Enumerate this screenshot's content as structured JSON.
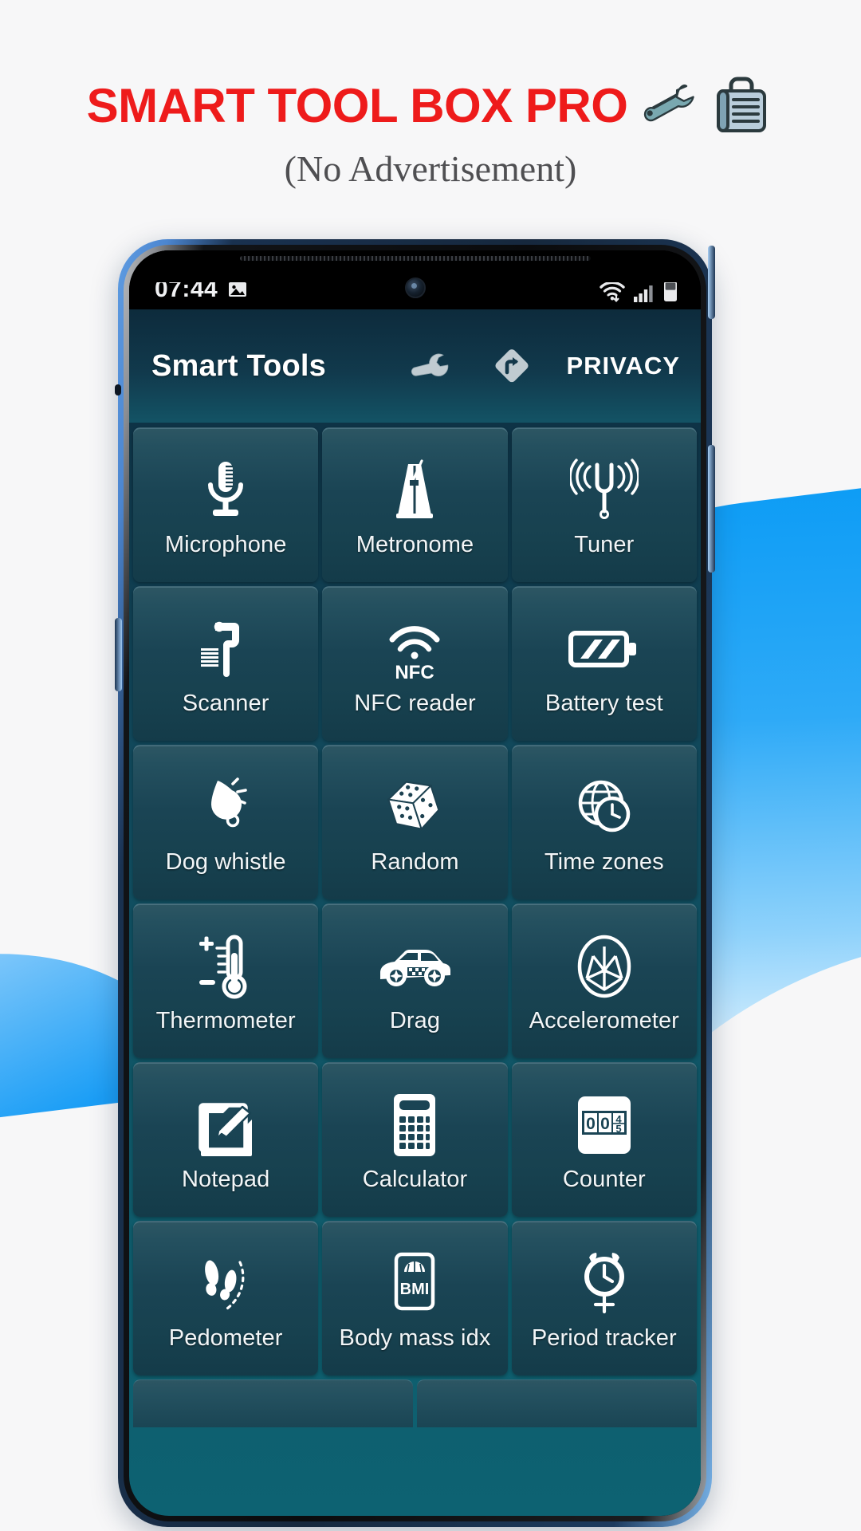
{
  "promo": {
    "title": "SMART TOOL BOX PRO",
    "subtitle": "(No Advertisement)",
    "title_color": "#ee1b1b",
    "subtitle_color": "#4f4f52",
    "icons": [
      "wrench-icon",
      "toolbox-icon"
    ]
  },
  "phone": {
    "statusbar": {
      "time": "07:44",
      "left_icons": [
        "photo-icon"
      ],
      "right_icons": [
        "wifi-icon",
        "signal-icon",
        "battery-icon"
      ]
    },
    "appbar": {
      "title": "Smart Tools",
      "wrench_icon": "wrench-icon",
      "navigation_icon": "navigation-diamond-icon",
      "privacy_label": "PRIVACY"
    },
    "grid": {
      "tiles": [
        {
          "label": "Microphone",
          "icon": "microphone-icon"
        },
        {
          "label": "Metronome",
          "icon": "metronome-icon"
        },
        {
          "label": "Tuner",
          "icon": "tuning-fork-icon"
        },
        {
          "label": "Scanner",
          "icon": "barcode-scanner-icon"
        },
        {
          "label": "NFC reader",
          "icon": "nfc-icon"
        },
        {
          "label": "Battery test",
          "icon": "battery-test-icon"
        },
        {
          "label": "Dog whistle",
          "icon": "whistle-icon"
        },
        {
          "label": "Random",
          "icon": "dice-icon"
        },
        {
          "label": "Time zones",
          "icon": "globe-clock-icon"
        },
        {
          "label": "Thermometer",
          "icon": "thermometer-icon"
        },
        {
          "label": "Drag",
          "icon": "car-icon"
        },
        {
          "label": "Accelerometer",
          "icon": "accelerometer-icon"
        },
        {
          "label": "Notepad",
          "icon": "notepad-pencil-icon"
        },
        {
          "label": "Calculator",
          "icon": "calculator-icon"
        },
        {
          "label": "Counter",
          "icon": "counter-icon"
        },
        {
          "label": "Pedometer",
          "icon": "footsteps-icon"
        },
        {
          "label": "Body mass idx",
          "icon": "bmi-scale-icon"
        },
        {
          "label": "Period tracker",
          "icon": "period-clock-icon"
        }
      ],
      "counter_icon_text": "00",
      "nfc_icon_text": "NFC",
      "bmi_icon_text": "BMI"
    },
    "theme": {
      "appbar_bg": "#11394c",
      "screen_bg": "#0f5a6a",
      "tile_bg": "#1a4454",
      "tile_text": "#f2f6f8"
    }
  },
  "background": {
    "page_bg": "#f7f7f8",
    "swoosh_color": "#109cf5"
  }
}
